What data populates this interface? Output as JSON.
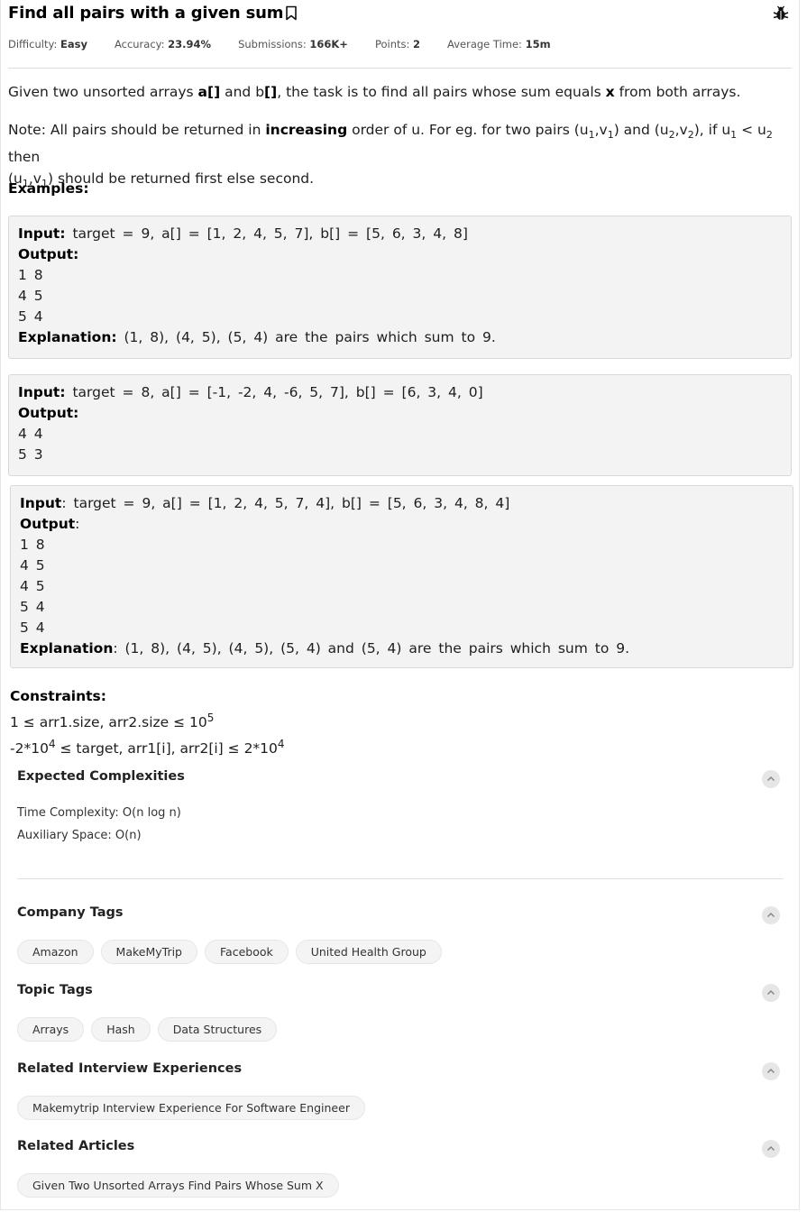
{
  "problem": {
    "title": "Find all pairs with a given sum",
    "meta": {
      "difficulty_label": "Difficulty:",
      "difficulty": "Easy",
      "accuracy_label": "Accuracy:",
      "accuracy": "23.94%",
      "submissions_label": "Submissions:",
      "submissions": "166K+",
      "points_label": "Points:",
      "points": "2",
      "avg_time_label": "Average Time:",
      "avg_time": "15m"
    },
    "desc1": {
      "pre": "Given two unsorted arrays ",
      "a": "a[]",
      "mid": " and b",
      "b": "[]",
      "post": ", the task is to find all pairs whose sum equals ",
      "x": "x",
      "end": " from both arrays."
    },
    "note": {
      "pre": "Note: All pairs should be returned in ",
      "bold": "increasing",
      "post": " order of u. For eg. for two pairs (u",
      "s1": "1",
      "c1": ",v",
      "s2": "1",
      "c2": ") and (u",
      "s3": "2",
      "c3": ",v",
      "s4": "2",
      "c4": "), if u",
      "s5": "1",
      "c5": " < u",
      "s6": "2",
      "c6": " then",
      "l2a": "(u",
      "s7": "1",
      "c7": ",v",
      "s8": "1",
      "l2b": ") should be returned first else second."
    },
    "examples_label": "Examples:",
    "examples": [
      {
        "input_label": "Input:",
        "input": "target = 9, a[] = [1, 2, 4, 5, 7], b[] = [5, 6, 3, 4, 8]",
        "output_label": "Output:",
        "outputs": [
          "1 8",
          "4 5",
          "5 4"
        ],
        "explanation_label": "Explanation:",
        "explanation": "(1, 8), (4, 5), (5, 4) are the pairs which sum to 9."
      },
      {
        "input_label": "Input:",
        "input": "target = 8, a[] = [-1, -2, 4, -6, 5, 7], b[] = [6, 3, 4, 0]",
        "output_label": "Output:",
        "outputs": [
          "4 4",
          "5 3"
        ]
      },
      {
        "input_label": "Input",
        "input": ": target = 9, a[] = [1, 2, 4, 5, 7, 4], b[] = [5, 6, 3, 4, 8, 4]",
        "output_label": "Output",
        "output_colon": ":",
        "outputs": [
          "1 8",
          "4 5",
          "4 5",
          "5 4",
          "5 4"
        ],
        "explanation_label": "Explanation",
        "explanation": ": (1, 8), (4, 5), (4, 5), (5, 4) and (5, 4) are the pairs which sum to 9."
      }
    ],
    "constraints_label": "Constraints:",
    "constraint1": {
      "pre": "1 ≤ arr1.size, arr2.size ≤ 10",
      "sup": "5"
    },
    "constraint2": {
      "pre": "-2*10",
      "sup1": "4",
      "mid": " ≤ target, arr1[i], arr2[i] ≤ 2*10",
      "sup2": "4"
    }
  },
  "sections": {
    "complexities": {
      "title": "Expected Complexities",
      "time": "Time Complexity: O(n log n)",
      "space": "Auxiliary Space: O(n)"
    },
    "company_tags": {
      "title": "Company Tags",
      "tags": [
        "Amazon",
        "MakeMyTrip",
        "Facebook",
        "United Health Group"
      ]
    },
    "topic_tags": {
      "title": "Topic Tags",
      "tags": [
        "Arrays",
        "Hash",
        "Data Structures"
      ]
    },
    "interview": {
      "title": "Related Interview Experiences",
      "tags": [
        "Makemytrip Interview Experience For Software Engineer"
      ]
    },
    "articles": {
      "title": "Related Articles",
      "tags": [
        "Given Two Unsorted Arrays Find Pairs Whose Sum X"
      ]
    }
  },
  "icons": {
    "bookmark": "bookmark-icon",
    "bug": "bug-icon",
    "collapse": "chevron-up-icon"
  }
}
